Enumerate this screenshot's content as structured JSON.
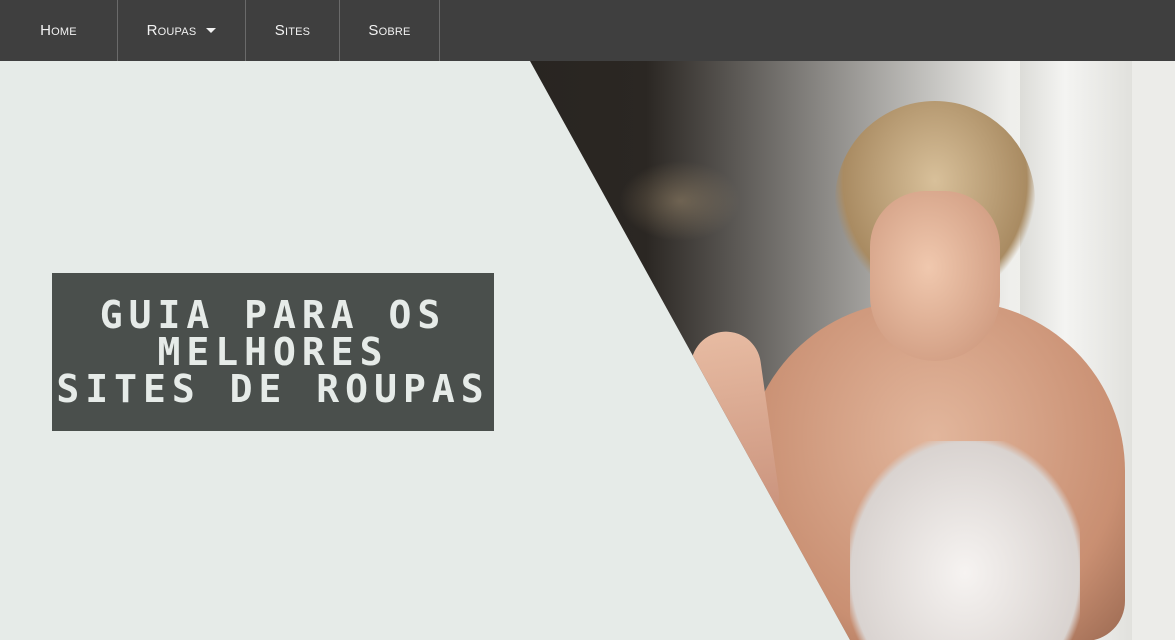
{
  "nav": {
    "items": [
      {
        "label": "Home"
      },
      {
        "label": "Roupas",
        "has_dropdown": true
      },
      {
        "label": "Sites"
      },
      {
        "label": "Sobre"
      }
    ]
  },
  "hero": {
    "title_lines": [
      "GUIA PARA OS",
      "MELHORES",
      "SITES DE ROUPAS"
    ]
  },
  "colors": {
    "navbar": "#3f3f3f",
    "background": "#e6ebe8",
    "title_box": "#4a4f4c",
    "title_text": "#e6ebe8"
  }
}
